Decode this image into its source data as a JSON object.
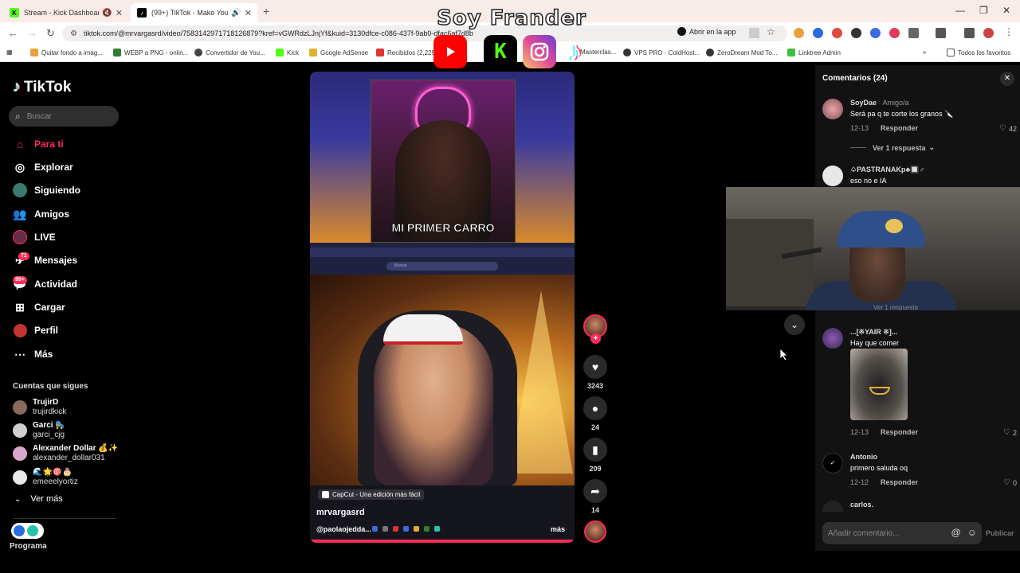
{
  "browser": {
    "tabs": [
      {
        "title": "Stream - Kick Dashboard",
        "state": "inactive"
      },
      {
        "title": "(99+) TikTok - Make Your Day",
        "state": "active"
      }
    ],
    "url": "tiktok.com/@mrvargasrd/video/7583142971718126879?kref=vGWRdzLJnjYf&kuid=3130dfce-c086-437f-9ab0-dfac6af7d8b",
    "open_in_app": "Abrir en la app",
    "bookmarks": [
      "Quitar fondo a imag...",
      "WEBP a PNG - onlin...",
      "Convertidor de You...",
      "Kick",
      "Google AdSense",
      "Recibidos (2,229)",
      "Masterclas...",
      "VPS PRO - ColdHost...",
      "ZeroDream Mod To...",
      "Linktree Admin"
    ],
    "all_bookmarks": "Todos los favoritos"
  },
  "overlay": {
    "title": "Soy Frander"
  },
  "sidebar": {
    "logo": "TikTok",
    "search_placeholder": "Buscar",
    "nav": [
      {
        "label": "Para ti",
        "icon": "home-icon",
        "active": true
      },
      {
        "label": "Explorar",
        "icon": "compass-icon"
      },
      {
        "label": "Siguiendo",
        "icon": "following-avatar-icon"
      },
      {
        "label": "Amigos",
        "icon": "friends-icon"
      },
      {
        "label": "LIVE",
        "icon": "live-icon"
      },
      {
        "label": "Mensajes",
        "icon": "messages-icon",
        "badge": "71"
      },
      {
        "label": "Actividad",
        "icon": "activity-icon",
        "badge": "99+"
      },
      {
        "label": "Cargar",
        "icon": "upload-icon"
      },
      {
        "label": "Perfil",
        "icon": "profile-icon"
      },
      {
        "label": "Más",
        "icon": "more-icon"
      }
    ],
    "following_title": "Cuentas que sigues",
    "following": [
      {
        "name": "TrujirD",
        "handle": "trujirdkick"
      },
      {
        "name": "Garci 🛼",
        "handle": "garci_cjg"
      },
      {
        "name": "Alexander Dollar 💰✨",
        "handle": "alexander_dollar031"
      },
      {
        "name": "🌊🌟🎯🎂",
        "handle": "emeeelyortiz"
      }
    ],
    "see_more": "Ver más",
    "program": "Programa"
  },
  "video": {
    "inner_banner": "MI PRIMER CARRO",
    "inner_search": "Buscar",
    "capcut": "CapCut - Una edición más fácil",
    "username": "mrvargasrd",
    "caption": "@paolaojedda...",
    "more": "más",
    "progress": 1.0
  },
  "actions": {
    "likes": "3243",
    "comments": "24",
    "saves": "209",
    "shares": "14"
  },
  "comments": {
    "title": "Comentarios (24)",
    "items": [
      {
        "user": "SoyDae",
        "relation": "· Amigo/a",
        "text": "Será pa q te corte los granos 🔪",
        "date": "12-13",
        "reply": "Responder",
        "likes": "42",
        "view_replies": "Ver 1 respuesta"
      },
      {
        "user": "♤PASTRANAKp♣🔲♂",
        "text": "eso no e IA"
      },
      {
        "user": "...[※YAIR ※]...",
        "text": "Hay que comer",
        "date": "12-13",
        "reply": "Responder",
        "likes": "2"
      },
      {
        "user": "Antonio",
        "text": "primero saluda oq",
        "date": "12-12",
        "reply": "Responder",
        "likes": "0"
      },
      {
        "user": "carlos.",
        "text": ""
      }
    ],
    "partial_replies": "Ver 1 respuesta",
    "input_placeholder": "Añadir comentario...",
    "publish": "Publicar"
  }
}
